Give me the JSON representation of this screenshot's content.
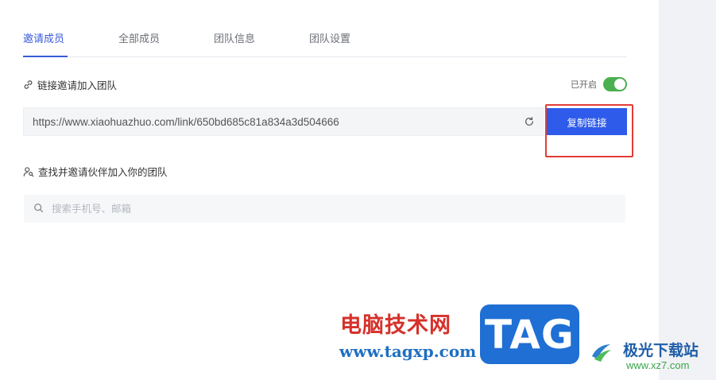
{
  "tabs": [
    {
      "label": "邀请成员",
      "active": true
    },
    {
      "label": "全部成员",
      "active": false
    },
    {
      "label": "团队信息",
      "active": false
    },
    {
      "label": "团队设置",
      "active": false
    }
  ],
  "link_section": {
    "title": "链接邀请加入团队",
    "icon": "link-icon",
    "toggle_status": "已开启",
    "toggle_on": true,
    "url": "https://www.xiaohuazhuo.com/link/650bd685c81a834a3d504666",
    "refresh_icon": "refresh-icon",
    "copy_label": "复制链接"
  },
  "find_section": {
    "title": "查找并邀请伙伴加入你的团队",
    "icon": "user-search-icon",
    "search_placeholder": "搜索手机号、邮箱",
    "search_icon": "search-icon"
  },
  "watermark": {
    "cn_text": "电脑技术网",
    "url_text": "www.tagxp.com",
    "tag_text": "TAG",
    "site_name": "极光下载站",
    "site_url": "www.xz7.com"
  },
  "colors": {
    "accent": "#3a5bd9",
    "button": "#2f5bea",
    "toggle_on": "#4caf50",
    "highlight": "#e43c36"
  }
}
